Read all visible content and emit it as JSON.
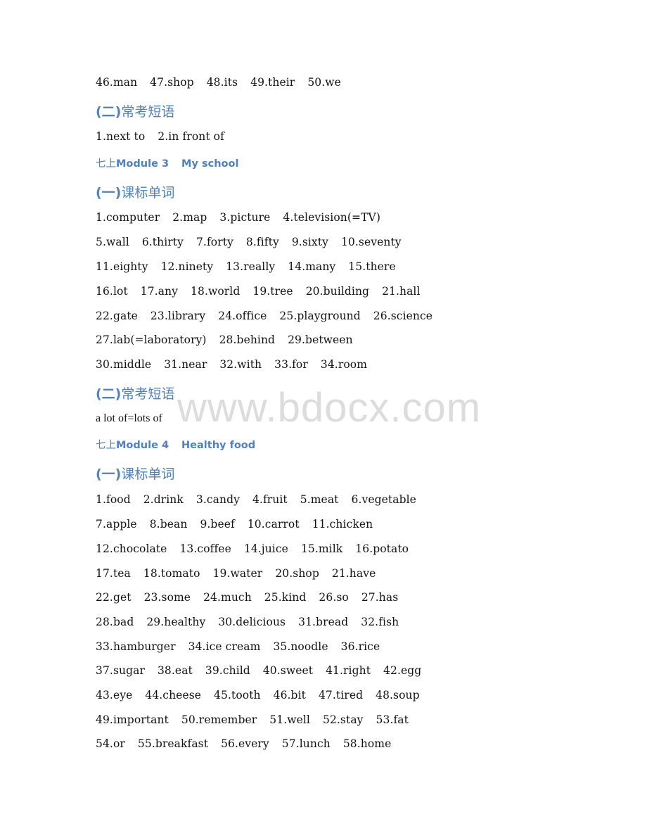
{
  "watermark": "www.bdocx.com",
  "colors": {
    "heading": "#4f81bd",
    "body_text": "#111111",
    "watermark": "#dcdcdc"
  },
  "blocks": [
    {
      "type": "words",
      "items": [
        "46.man",
        "47.shop",
        "48.its",
        "49.their",
        "50.we"
      ]
    },
    {
      "type": "section",
      "prefix": "(二)",
      "title": "常考短语"
    },
    {
      "type": "words",
      "items": [
        "1.next to",
        "2.in front of"
      ]
    },
    {
      "type": "module",
      "cn": "七上",
      "module": "Module 3",
      "topic": "My school"
    },
    {
      "type": "section",
      "prefix": "(一)",
      "title": "课标单词"
    },
    {
      "type": "words",
      "items": [
        "1.computer",
        "2.map",
        "3.picture",
        "4.television(=TV)"
      ]
    },
    {
      "type": "words",
      "items": [
        "5.wall",
        "6.thirty",
        "7.forty",
        "8.fifty",
        "9.sixty",
        "10.seventy"
      ]
    },
    {
      "type": "words",
      "items": [
        "11.eighty",
        "12.ninety",
        "13.really",
        "14.many",
        "15.there"
      ]
    },
    {
      "type": "words",
      "items": [
        "16.lot",
        "17.any",
        "18.world",
        "19.tree",
        "20.building",
        "21.hall"
      ]
    },
    {
      "type": "words",
      "items": [
        "22.gate",
        "23.library",
        "24.office",
        "25.playground",
        "26.science"
      ]
    },
    {
      "type": "words",
      "items": [
        "27.lab(=laboratory)",
        "28.behind",
        "29.between"
      ]
    },
    {
      "type": "words",
      "items": [
        "30.middle",
        "31.near",
        "32.with",
        "33.for",
        "34.room"
      ]
    },
    {
      "type": "section",
      "prefix": "(二)",
      "title": "常考短语"
    },
    {
      "type": "phrase",
      "text": "a lot of=lots of"
    },
    {
      "type": "module",
      "cn": "七上",
      "module": "Module 4",
      "topic": "Healthy food"
    },
    {
      "type": "section",
      "prefix": "(一)",
      "title": "课标单词"
    },
    {
      "type": "words",
      "items": [
        "1.food",
        "2.drink",
        "3.candy",
        "4.fruit",
        "5.meat",
        "6.vegetable"
      ]
    },
    {
      "type": "words",
      "items": [
        "7.apple",
        "8.bean",
        "9.beef",
        "10.carrot",
        "11.chicken"
      ]
    },
    {
      "type": "words",
      "items": [
        "12.chocolate",
        "13.coffee",
        "14.juice",
        "15.milk",
        "16.potato"
      ]
    },
    {
      "type": "words",
      "items": [
        "17.tea",
        "18.tomato",
        "19.water",
        "20.shop",
        "21.have"
      ]
    },
    {
      "type": "words",
      "items": [
        "22.get",
        "23.some",
        "24.much",
        "25.kind",
        "26.so",
        "27.has"
      ]
    },
    {
      "type": "words",
      "items": [
        "28.bad",
        "29.healthy",
        "30.delicious",
        "31.bread",
        "32.fish"
      ]
    },
    {
      "type": "words",
      "items": [
        "33.hamburger",
        "34.ice cream",
        "35.noodle",
        "36.rice"
      ]
    },
    {
      "type": "words",
      "items": [
        "37.sugar",
        "38.eat",
        "39.child",
        "40.sweet",
        "41.right",
        "42.egg"
      ]
    },
    {
      "type": "words",
      "items": [
        "43.eye",
        "44.cheese",
        "45.tooth",
        "46.bit",
        "47.tired",
        "48.soup"
      ]
    },
    {
      "type": "words",
      "items": [
        "49.important",
        "50.remember",
        "51.well",
        "52.stay",
        "53.fat"
      ]
    },
    {
      "type": "words",
      "items": [
        "54.or",
        "55.breakfast",
        "56.every",
        "57.lunch",
        "58.home"
      ]
    }
  ]
}
